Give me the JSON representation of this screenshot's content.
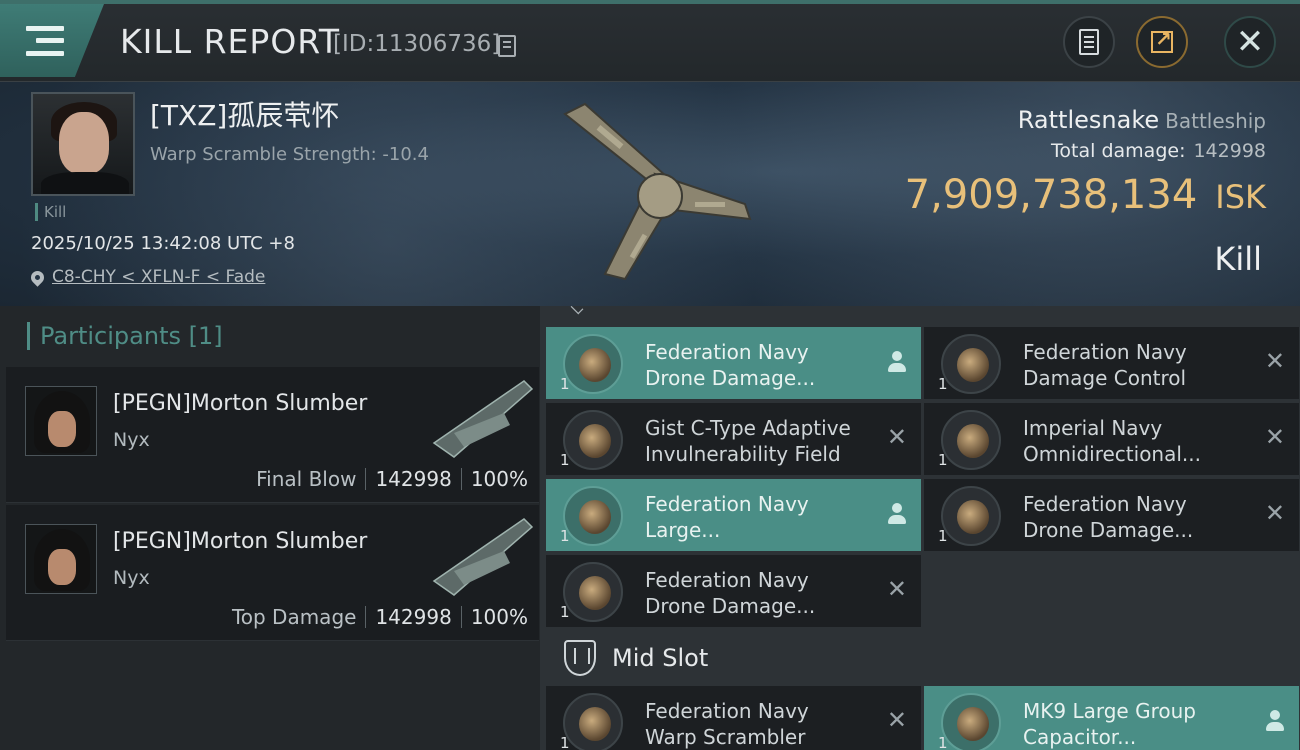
{
  "header": {
    "title": "KILL REPORT",
    "report_id": "[ID:11306736]"
  },
  "victim": {
    "name": "[TXZ]孤辰茕怀",
    "warp_scramble": "Warp Scramble Strength: -10.4",
    "kill_tag": "Kill",
    "datetime": "2025/10/25 13:42:08 UTC +8",
    "location": "C8-CHY < XFLN-F < Fade",
    "ship_name": "Rattlesnake",
    "ship_class": "Battleship",
    "total_damage_label": "Total damage:",
    "total_damage": "142998",
    "isk_value": "7,909,738,134",
    "isk_unit": "ISK",
    "result": "Kill"
  },
  "participants": {
    "title": "Participants [1]",
    "rows": [
      {
        "name": "[PEGN]Morton Slumber",
        "ship": "Nyx",
        "role": "Final Blow",
        "damage": "142998",
        "percent": "100%"
      },
      {
        "name": "[PEGN]Morton Slumber",
        "ship": "Nyx",
        "role": "Top Damage",
        "damage": "142998",
        "percent": "100%"
      }
    ]
  },
  "fitting": {
    "high_slots": [
      {
        "line1": "Federation Navy",
        "line2": "Drone Damage...",
        "qty": "1",
        "highlighted": true,
        "icon": "drone-damage-icon"
      },
      {
        "line1": "Federation Navy",
        "line2": "Damage Control",
        "qty": "1",
        "highlighted": false,
        "icon": "damage-control-icon"
      },
      {
        "line1": "Gist C-Type Adaptive",
        "line2": "Invulnerability Field",
        "qty": "1",
        "highlighted": false,
        "icon": "invulnerability-field-icon"
      },
      {
        "line1": "Imperial Navy",
        "line2": "Omnidirectional...",
        "qty": "1",
        "highlighted": false,
        "icon": "omnidirectional-icon"
      },
      {
        "line1": "Federation Navy",
        "line2": "Large...",
        "qty": "1",
        "highlighted": true,
        "icon": "capacitor-booster-icon"
      },
      {
        "line1": "Federation Navy",
        "line2": "Drone Damage...",
        "qty": "1",
        "highlighted": false,
        "icon": "drone-damage-icon"
      },
      {
        "line1": "Federation Navy",
        "line2": "Drone Damage...",
        "qty": "1",
        "highlighted": false,
        "icon": "drone-damage-icon"
      }
    ],
    "mid_slot_title": "Mid Slot",
    "mid_slots": [
      {
        "line1": "Federation Navy",
        "line2": "Warp Scrambler",
        "qty": "1",
        "highlighted": false,
        "icon": "warp-scrambler-icon"
      },
      {
        "line1": "MK9 Large Group",
        "line2": "Capacitor...",
        "qty": "1",
        "highlighted": true,
        "icon": "capacitor-icon"
      }
    ]
  },
  "colors": {
    "accent": "#4a8e86",
    "isk": "#e8c07a",
    "panel": "#1c1f22"
  }
}
